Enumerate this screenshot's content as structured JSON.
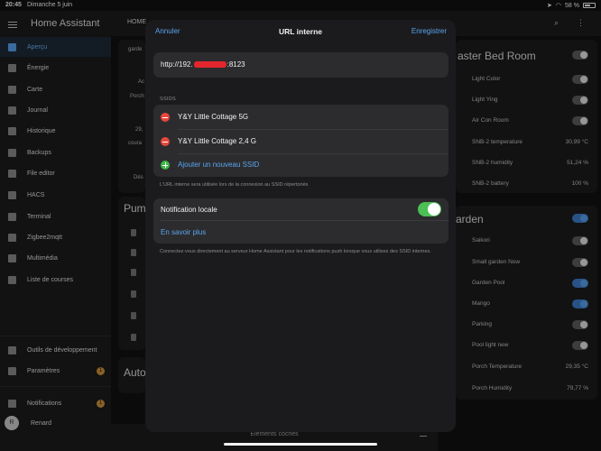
{
  "status": {
    "time": "20:45",
    "date": "Dimanche 5 juin",
    "battery": "58 %"
  },
  "sidebar": {
    "title": "Home Assistant",
    "items": [
      {
        "label": "Aperçu",
        "icon": "grid-icon",
        "active": true
      },
      {
        "label": "Énergie",
        "icon": "lightning-icon"
      },
      {
        "label": "Carte",
        "icon": "map-icon"
      },
      {
        "label": "Journal",
        "icon": "journal-icon"
      },
      {
        "label": "Historique",
        "icon": "chart-icon"
      },
      {
        "label": "Backups",
        "icon": "cloud-icon"
      },
      {
        "label": "File editor",
        "icon": "wrench-icon"
      },
      {
        "label": "HACS",
        "icon": "hacs-icon"
      },
      {
        "label": "Terminal",
        "icon": "terminal-icon"
      },
      {
        "label": "Zigbee2mqtt",
        "icon": "zigbee-icon"
      },
      {
        "label": "Multimédia",
        "icon": "play-icon"
      },
      {
        "label": "Liste de courses",
        "icon": "cart-icon"
      }
    ],
    "dev_tools": "Outils de développement",
    "settings": "Paramètres",
    "settings_badge": "1",
    "notifications": "Notifications",
    "notifications_badge": "1",
    "user_initial": "R",
    "user_name": "Renard"
  },
  "topbar": {
    "tab": "HOME"
  },
  "background": {
    "left_card_title": "garde",
    "left_texts": [
      "Ac",
      "Porch",
      "29,",
      "coura",
      "Dés"
    ],
    "pump_title": "Pump",
    "auto_title": "Auto",
    "master_card": {
      "title": "aster Bed Room",
      "rows": [
        {
          "name": "Light Color",
          "type": "toggle",
          "on": false
        },
        {
          "name": "Light Ying",
          "type": "toggle",
          "on": false
        },
        {
          "name": "Air Con Room",
          "type": "toggle",
          "on": false
        },
        {
          "name": "SNB-2 temperature",
          "type": "value",
          "value": "30,99 °C"
        },
        {
          "name": "SNB-2 humidity",
          "type": "value",
          "value": "51,24 %"
        },
        {
          "name": "SNB-2 battery",
          "type": "value",
          "value": "100 %"
        }
      ]
    },
    "garden_card": {
      "title": "arden",
      "rows": [
        {
          "name": "Saikori",
          "type": "toggle",
          "on": false
        },
        {
          "name": "Small garden Now",
          "type": "toggle",
          "on": false
        },
        {
          "name": "Garden Pool",
          "type": "toggle",
          "on": true
        },
        {
          "name": "Mango",
          "type": "toggle",
          "on": true
        },
        {
          "name": "Parking",
          "type": "toggle",
          "on": false
        },
        {
          "name": "Pool light new",
          "type": "toggle",
          "on": false
        },
        {
          "name": "Porch Temperature",
          "type": "value",
          "value": "29,35 °C"
        },
        {
          "name": "Porch Humidity",
          "type": "value",
          "value": "79,77 %"
        }
      ]
    },
    "bottom_label": "Éléments cochés"
  },
  "modal": {
    "cancel_label": "Annuler",
    "title": "URL interne",
    "save_label": "Enregistrer",
    "url_prefix": "http://192.",
    "url_suffix": ":8123",
    "ssids_label": "SSIDS",
    "ssids": [
      "Y&Y Little Cottage 5G",
      "Y&Y Little Cottage 2,4 G"
    ],
    "add_ssid_label": "Ajouter un nouveau SSID",
    "ssid_hint": "L'URL interne sera utilisée lors de la connexion au SSID répertoriés",
    "local_notification_label": "Notification locale",
    "local_notification_on": true,
    "learn_more_label": "En savoir plus",
    "notification_hint": "Connectez-vous directement au serveur Home Assistant pour les notifications push lorsque vous utilisez des SSID internes."
  }
}
